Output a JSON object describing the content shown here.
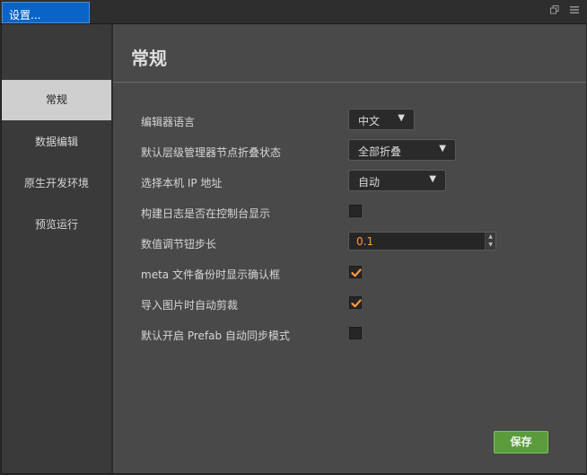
{
  "window": {
    "tab_title": "设置...",
    "icons": [
      "restore-icon",
      "menu-icon"
    ]
  },
  "sidebar": {
    "items": [
      {
        "label": "常规",
        "active": true
      },
      {
        "label": "数据编辑",
        "active": false
      },
      {
        "label": "原生开发环境",
        "active": false
      },
      {
        "label": "预览运行",
        "active": false
      }
    ]
  },
  "main": {
    "title": "常规",
    "settings": {
      "editor_language": {
        "label": "编辑器语言",
        "value": "中文"
      },
      "hierarchy_fold": {
        "label": "默认层级管理器节点折叠状态",
        "value": "全部折叠"
      },
      "local_ip": {
        "label": "选择本机 IP 地址",
        "value": "自动"
      },
      "build_log_console": {
        "label": "构建日志是否在控制台显示",
        "checked": false
      },
      "step_length": {
        "label": "数值调节钮步长",
        "value": "0.1"
      },
      "meta_backup_confirm": {
        "label": "meta 文件备份时显示确认框",
        "checked": true
      },
      "auto_trim_images": {
        "label": "导入图片时自动剪裁",
        "checked": true
      },
      "prefab_auto_sync": {
        "label": "默认开启 Prefab 自动同步模式",
        "checked": false
      }
    },
    "save_label": "保存"
  },
  "colors": {
    "accent_blue": "#0a64c8",
    "checkmark_orange": "#ff9a3c",
    "save_green": "#5a9c3c",
    "sidebar_active": "#cfcfcf"
  }
}
